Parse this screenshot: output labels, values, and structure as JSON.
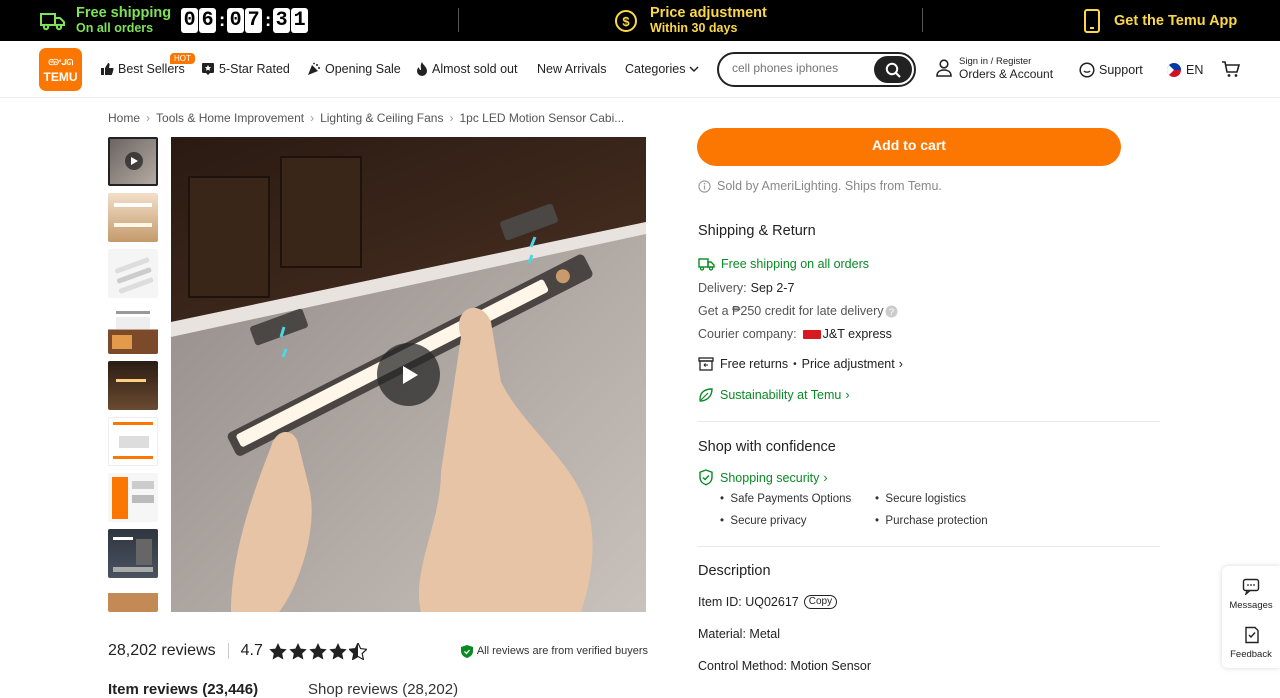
{
  "topbar": {
    "free_shipping_title": "Free shipping",
    "free_shipping_sub": "On all orders",
    "countdown": [
      "0",
      "6",
      "0",
      "7",
      "3",
      "1"
    ],
    "price_adj_title": "Price adjustment",
    "price_adj_sub": "Within 30 days",
    "app_label": "Get the Temu App"
  },
  "nav": {
    "logo_top": "ᘓᘐᐤᒍᘏ",
    "logo_text": "TEMU",
    "best_sellers": "Best Sellers",
    "hot_badge": "HOT",
    "five_star": "5-Star Rated",
    "opening_sale": "Opening Sale",
    "almost_sold_out": "Almost sold out",
    "new_arrivals": "New Arrivals",
    "categories": "Categories",
    "search_placeholder": "cell phones iphones",
    "sign_in": "Sign in / Register",
    "orders_account": "Orders & Account",
    "support": "Support",
    "lang": "EN"
  },
  "breadcrumb": [
    "Home",
    "Tools & Home Improvement",
    "Lighting & Ceiling Fans",
    "1pc LED Motion Sensor Cabi..."
  ],
  "reviews": {
    "count": "28,202 reviews",
    "rating": "4.7",
    "verified": "All reviews are from verified buyers",
    "item_reviews": "Item reviews (23,446)",
    "shop_reviews": "Shop reviews (28,202)"
  },
  "purchase": {
    "add_to_cart": "Add to cart",
    "sold_by": "Sold by AmeriLighting. Ships from Temu."
  },
  "shipping": {
    "title": "Shipping & Return",
    "free_shipping": "Free shipping on all orders",
    "delivery_label": "Delivery:",
    "delivery_value": "Sep 2-7",
    "credit": "Get a ₱250 credit for late delivery",
    "courier_label": "Courier company:",
    "courier_value": "J&T express",
    "returns": "Free returns",
    "price_adjustment": "Price adjustment",
    "sustainability": "Sustainability at Temu"
  },
  "confidence": {
    "title": "Shop with confidence",
    "security": "Shopping security",
    "items": [
      "Safe Payments Options",
      "Secure logistics",
      "Secure privacy",
      "Purchase protection"
    ]
  },
  "description": {
    "title": "Description",
    "item_id": "Item ID: UQ02617",
    "copy": "Copy",
    "material": "Material: Metal",
    "control": "Control Method: Motion Sensor"
  },
  "floating": {
    "messages": "Messages",
    "feedback": "Feedback"
  },
  "colors": {
    "brand": "#fb7701",
    "success_green": "#0a8a24",
    "topbar_bg": "#000000"
  }
}
